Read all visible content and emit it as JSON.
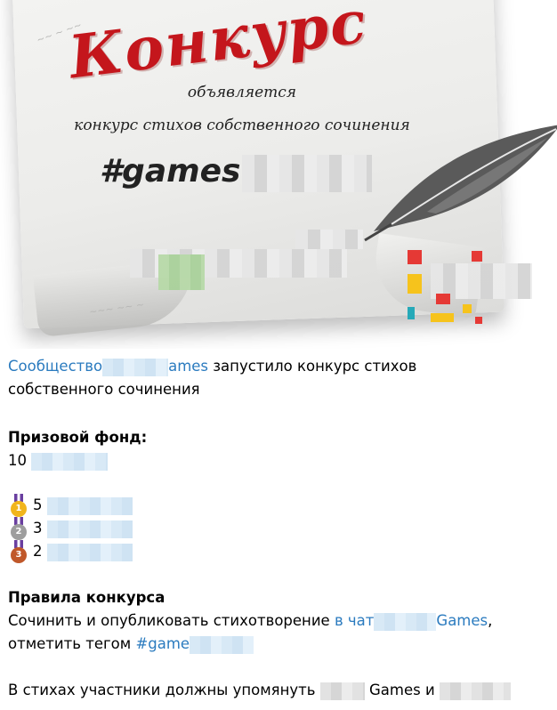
{
  "banner": {
    "title": "Конкурс",
    "announce": "объявляется",
    "subtitle": "конкурс стихов собственного сочинения",
    "hashtag": "#games",
    "colors": {
      "title_red": "#c4161c",
      "logo_red": "#e53935",
      "logo_yellow": "#f6c31c",
      "logo_teal": "#26a9b8"
    }
  },
  "post": {
    "intro_link": "Сообщество",
    "intro_link_tail": "ames",
    "intro_text": " запустило конкурс стихов",
    "intro_text2": "собственного сочинения",
    "prize_heading": "Призовой фонд:",
    "prize_total": "10",
    "places": [
      {
        "number": "1",
        "amount": "5",
        "medal_color": "#f1b51c"
      },
      {
        "number": "2",
        "amount": "3",
        "medal_color": "#9e9e9e"
      },
      {
        "number": "3",
        "amount": "2",
        "medal_color": "#c0582a"
      }
    ],
    "rules_heading": "Правила конкурса",
    "rules_text": "Сочинить и опубликовать стихотворение ",
    "rules_link": "в чат",
    "rules_link_tail": "Games",
    "rules_comma": ",",
    "tag_text": "отметить тегом ",
    "tag_link": "#game",
    "mention_text": "В стихах участники должны упомянуть ",
    "mention_games": "Games и "
  }
}
